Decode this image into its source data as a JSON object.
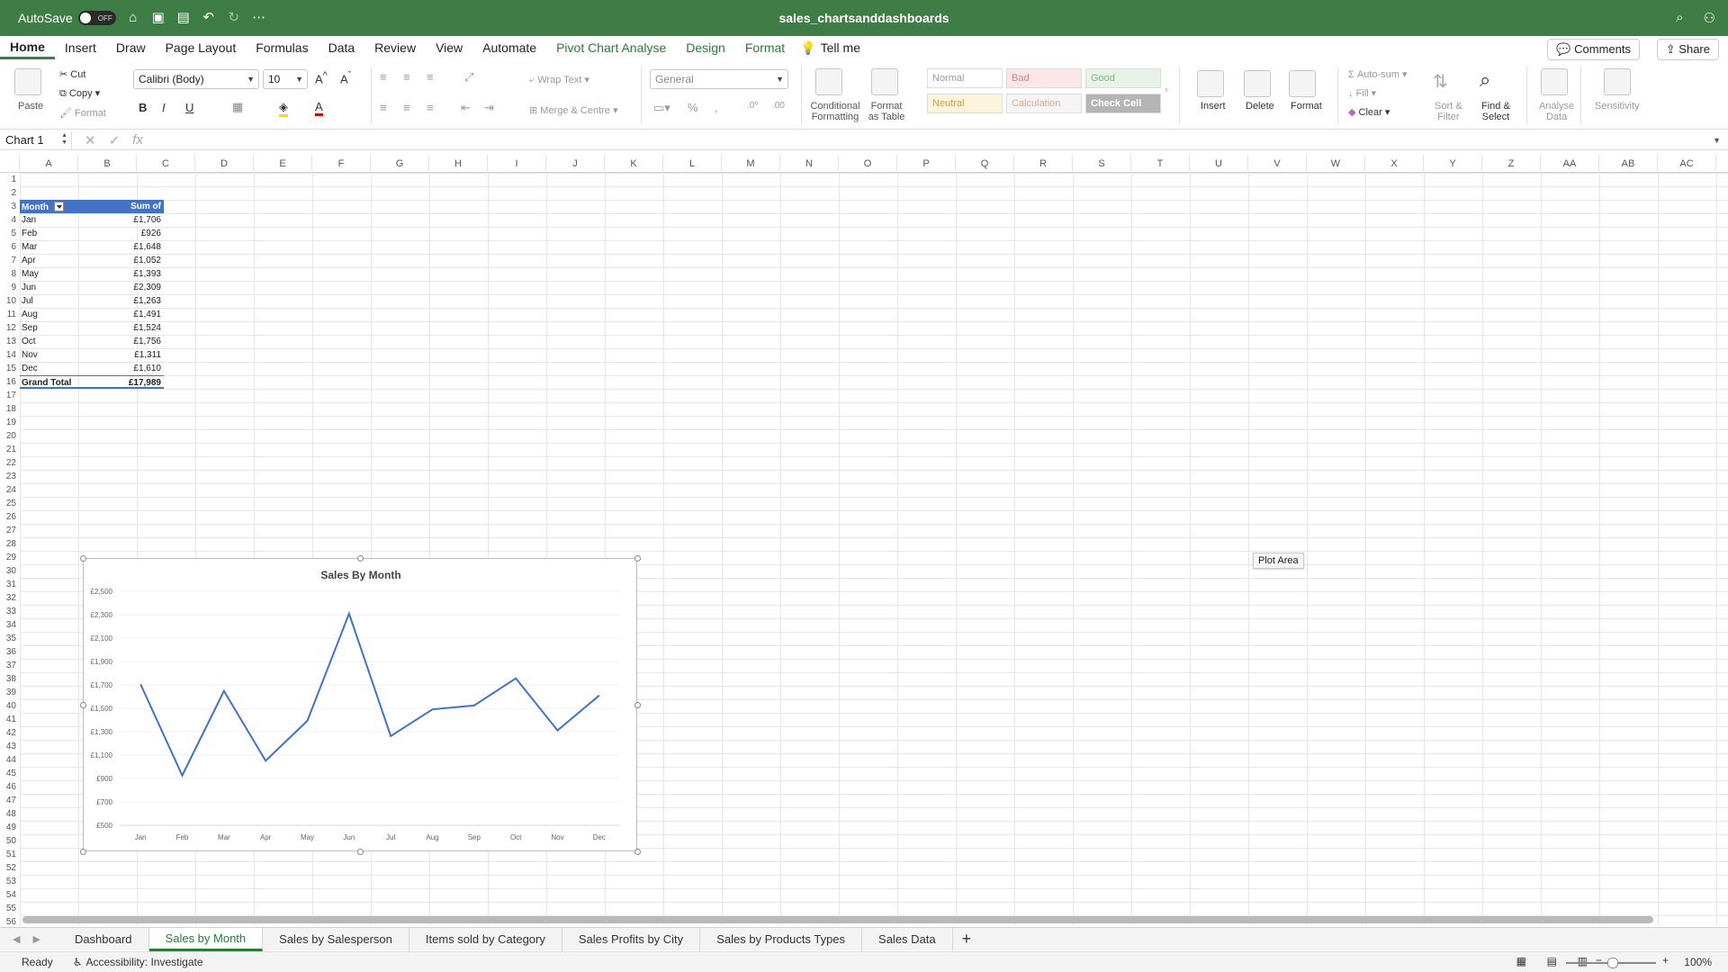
{
  "app": {
    "autosave_label": "AutoSave",
    "autosave_state": "OFF",
    "doc_title": "sales_chartsanddashboards"
  },
  "ribbon_tabs": [
    "Home",
    "Insert",
    "Draw",
    "Page Layout",
    "Formulas",
    "Data",
    "Review",
    "View",
    "Automate",
    "Pivot Chart Analyse",
    "Design",
    "Format"
  ],
  "tell_me": "Tell me",
  "comments_label": "Comments",
  "share_label": "Share",
  "ribbon": {
    "paste": "Paste",
    "cut": "Cut",
    "copy": "Copy",
    "format": "Format",
    "font_name": "Calibri (Body)",
    "font_size": "10",
    "bold": "B",
    "italic": "I",
    "underline": "U",
    "wrap_text": "Wrap Text",
    "merge_centre": "Merge & Centre",
    "number_format": "General",
    "conditional_formatting_1": "Conditional",
    "conditional_formatting_2": "Formatting",
    "format_as_table_1": "Format",
    "format_as_table_2": "as Table",
    "styles": {
      "normal": "Normal",
      "bad": "Bad",
      "good": "Good",
      "neutral": "Neutral",
      "calculation": "Calculation",
      "check_cell": "Check Cell"
    },
    "insert": "Insert",
    "delete": "Delete",
    "format_cells": "Format",
    "autosum": "Auto-sum",
    "fill": "Fill",
    "clear": "Clear",
    "sort_filter_1": "Sort &",
    "sort_filter_2": "Filter",
    "find_select_1": "Find &",
    "find_select_2": "Select",
    "analyse_data_1": "Analyse",
    "analyse_data_2": "Data",
    "sensitivity": "Sensitivity"
  },
  "name_box": "Chart 1",
  "fx_label": "fx",
  "columns": [
    "A",
    "B",
    "C",
    "D",
    "E",
    "F",
    "G",
    "H",
    "I",
    "J",
    "K",
    "L",
    "M",
    "N",
    "O",
    "P",
    "Q",
    "R",
    "S",
    "T",
    "U",
    "V",
    "W",
    "X",
    "Y",
    "Z",
    "AA",
    "AB",
    "AC"
  ],
  "pivot": {
    "header_month": "Month",
    "header_value": "Sum of TotalPrice",
    "rows": [
      {
        "month": "Jan",
        "value": "£1,706"
      },
      {
        "month": "Feb",
        "value": "£926"
      },
      {
        "month": "Mar",
        "value": "£1,648"
      },
      {
        "month": "Apr",
        "value": "£1,052"
      },
      {
        "month": "May",
        "value": "£1,393"
      },
      {
        "month": "Jun",
        "value": "£2,309"
      },
      {
        "month": "Jul",
        "value": "£1,263"
      },
      {
        "month": "Aug",
        "value": "£1,491"
      },
      {
        "month": "Sep",
        "value": "£1,524"
      },
      {
        "month": "Oct",
        "value": "£1,756"
      },
      {
        "month": "Nov",
        "value": "£1,311"
      },
      {
        "month": "Dec",
        "value": "£1,610"
      }
    ],
    "total_label": "Grand Total",
    "total_value": "£17,989"
  },
  "chart_data": {
    "type": "line",
    "title": "Sales By Month",
    "categories": [
      "Jan",
      "Feb",
      "Mar",
      "Apr",
      "May",
      "Jun",
      "Jul",
      "Aug",
      "Sep",
      "Oct",
      "Nov",
      "Dec"
    ],
    "values": [
      1706,
      926,
      1648,
      1052,
      1393,
      2309,
      1263,
      1491,
      1524,
      1756,
      1311,
      1610
    ],
    "ylim": [
      500,
      2500
    ],
    "yticks": [
      "£500",
      "£700",
      "£900",
      "£1,100",
      "£1,300",
      "£1,500",
      "£1,700",
      "£1,900",
      "£2,100",
      "£2,300",
      "£2,500"
    ],
    "line_color": "#4472c4",
    "grid": true
  },
  "tooltip": "Plot Area",
  "sheet_tabs": [
    "Dashboard",
    "Sales by Month",
    "Sales by Salesperson",
    "Items sold by Category",
    "Sales Profits by City",
    "Sales by Products Types",
    "Sales Data"
  ],
  "active_sheet": "Sales by Month",
  "status": {
    "ready": "Ready",
    "accessibility": "Accessibility: Investigate",
    "zoom": "100%"
  },
  "colors": {
    "accent": "#3f7d46",
    "pivot_header": "#4472c4"
  }
}
